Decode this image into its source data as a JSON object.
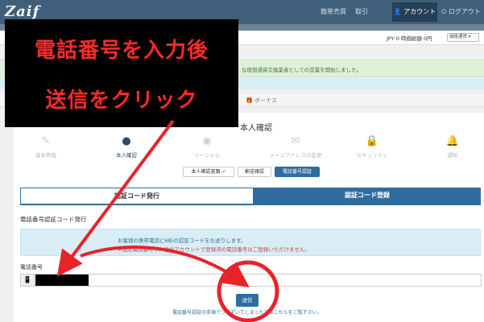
{
  "navbar": {
    "logo": "Zaif",
    "links": [
      "簡単売買",
      "取引"
    ],
    "account_label": "👤 アカウント",
    "logout_label": "⏻ ログアウト"
  },
  "balance": {
    "text": "JPY 0  時価総額 0円",
    "select_value": "価格通貨 ▾"
  },
  "notice": {
    "text": "な仮想通貨交換業者としての営業を開始しました。"
  },
  "tabs": {
    "bonus": "🎁 ボーナス"
  },
  "panel": {
    "title": "本人確認",
    "steps": [
      {
        "label": "基本情報",
        "icon": "pencil-icon",
        "glyph": "✎"
      },
      {
        "label": "本人確認",
        "icon": "user-icon",
        "glyph": "●"
      },
      {
        "label": "ソーシャル",
        "icon": "globe-icon",
        "glyph": "◉"
      },
      {
        "label": "メールアドレスの変更",
        "icon": "envelope-icon",
        "glyph": "✉"
      },
      {
        "label": "セキュリティ",
        "icon": "lock-icon",
        "glyph": "🔒"
      },
      {
        "label": "通知",
        "icon": "bell-icon",
        "glyph": "🔔"
      }
    ],
    "pills": [
      {
        "label": "本人確認書類",
        "check": "✔"
      },
      {
        "label": "郵送確認",
        "check": ""
      },
      {
        "label": "電話番号認証",
        "check": ""
      }
    ],
    "code_tabs": {
      "issue": "認証コード発行",
      "register": "認証コード登録"
    },
    "section_heading": "電話番号認証コード発行",
    "info_line1": "お客様の携帯電話に6桁の認証コードをお送りします。",
    "info_line2": "※固定電話番号や、他のアカウントで登録済の電話番号はご登録いただけません。",
    "phone_label": "電話番号",
    "phone_addon_glyph": "📱",
    "send_label": "送信",
    "help_text": "電話番号認証の手順でつまずいてしまった方はこちらをご覧下さい。"
  },
  "annotation": {
    "line1": "電話番号を入力後",
    "line2": "送信をクリック",
    "color": "#ff2a2a"
  }
}
